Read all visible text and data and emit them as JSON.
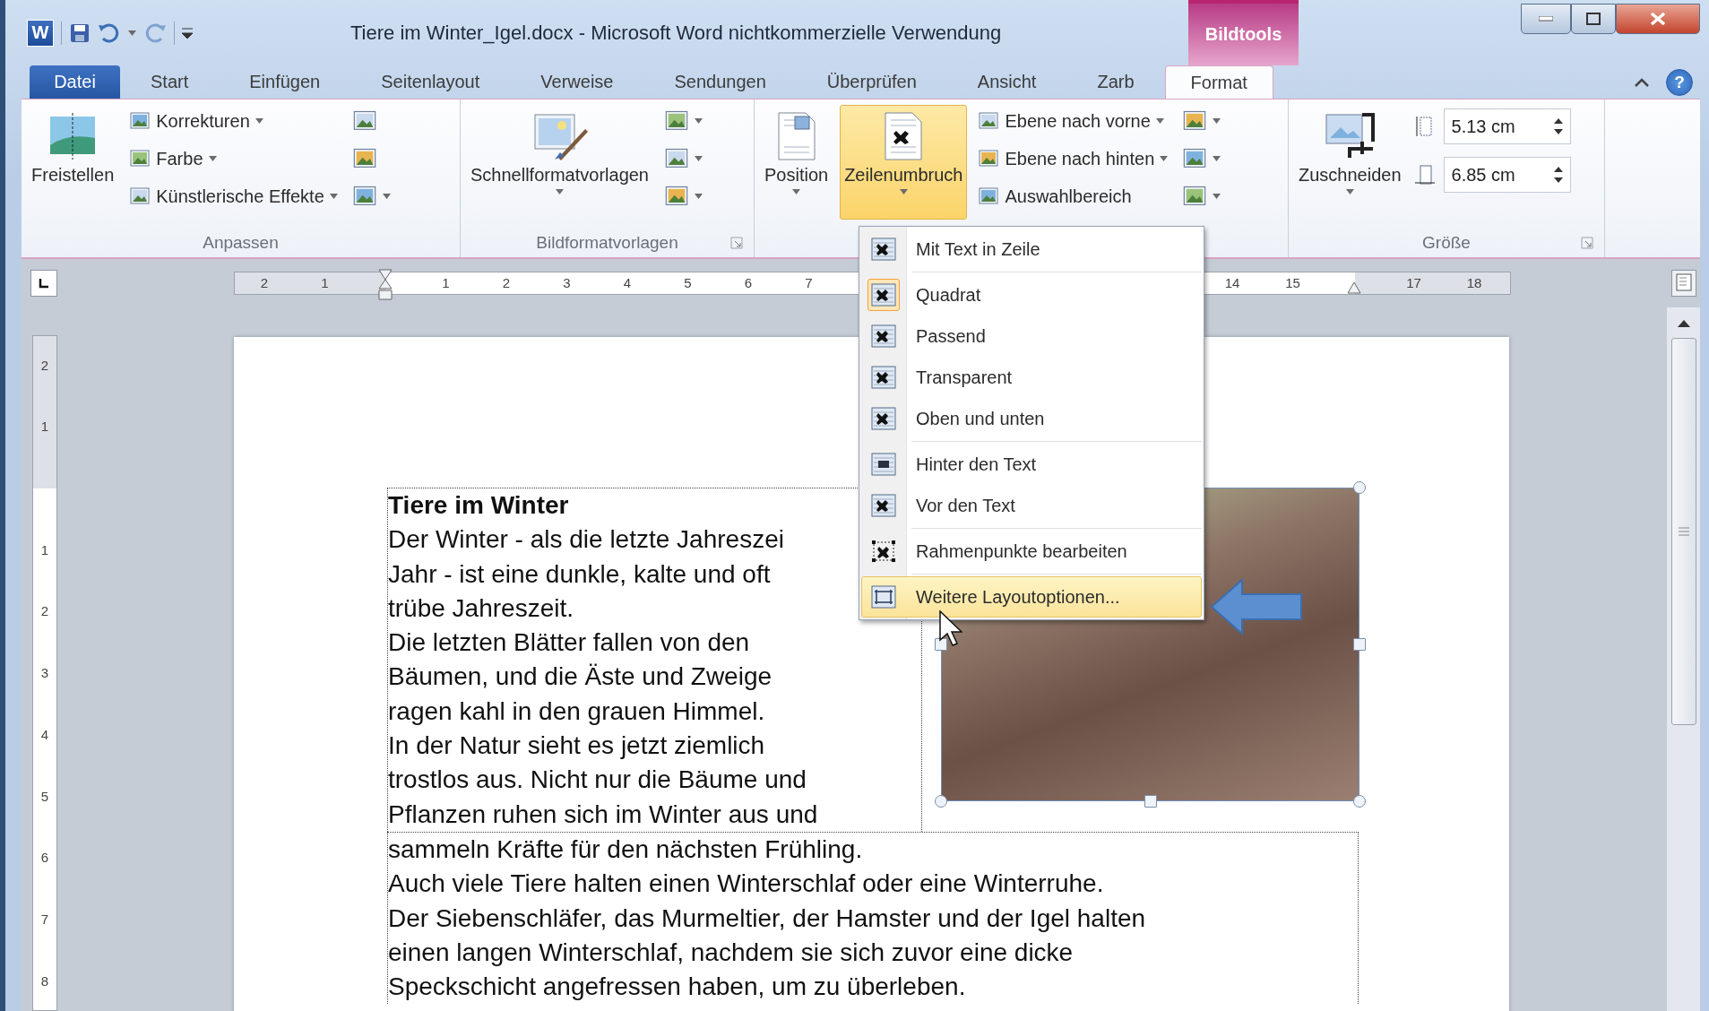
{
  "title_bar": {
    "app_icon": "W",
    "title": "Tiere im Winter_Igel.docx - Microsoft Word nichtkommerzielle Verwendung",
    "context_label": "Bildtools"
  },
  "tabs": [
    {
      "label": "Datei",
      "kind": "file",
      "selected": false
    },
    {
      "label": "Start",
      "kind": "normal",
      "selected": false
    },
    {
      "label": "Einfügen",
      "kind": "normal",
      "selected": false
    },
    {
      "label": "Seitenlayout",
      "kind": "normal",
      "selected": false
    },
    {
      "label": "Verweise",
      "kind": "normal",
      "selected": false
    },
    {
      "label": "Sendungen",
      "kind": "normal",
      "selected": false
    },
    {
      "label": "Überprüfen",
      "kind": "normal",
      "selected": false
    },
    {
      "label": "Ansicht",
      "kind": "normal",
      "selected": false
    },
    {
      "label": "Zarb",
      "kind": "normal",
      "selected": false
    },
    {
      "label": "Format",
      "kind": "context",
      "selected": true
    }
  ],
  "help": "?",
  "ribbon": {
    "groups": [
      {
        "label": "Anpassen",
        "launcher": false,
        "columns": [
          [
            {
              "kind": "large",
              "label": "Freistellen",
              "dropdown": false,
              "active": false
            }
          ],
          [
            {
              "kind": "small",
              "label": "Korrekturen",
              "dropdown": true
            },
            {
              "kind": "small",
              "label": "Farbe",
              "dropdown": true
            },
            {
              "kind": "small",
              "label": "Künstlerische Effekte",
              "dropdown": true
            }
          ],
          [
            {
              "kind": "icon",
              "dropdown": false
            },
            {
              "kind": "icon",
              "dropdown": false
            },
            {
              "kind": "icon",
              "dropdown": true
            }
          ]
        ]
      },
      {
        "label": "Bildformatvorlagen",
        "launcher": true,
        "columns": [
          [
            {
              "kind": "large",
              "label": "Schnellformatvorlagen",
              "dropdown": true,
              "active": false
            }
          ],
          [
            {
              "kind": "icon",
              "dropdown": true
            },
            {
              "kind": "icon",
              "dropdown": true
            },
            {
              "kind": "icon",
              "dropdown": true
            }
          ]
        ]
      },
      {
        "launcher": false,
        "columns": [
          [
            {
              "kind": "large",
              "label": "Position",
              "dropdown": true,
              "active": false
            }
          ],
          [
            {
              "kind": "large",
              "label": "Zeilenumbruch",
              "dropdown": true,
              "active": true
            }
          ],
          [
            {
              "kind": "small",
              "label": "Ebene nach vorne",
              "dropdown": true
            },
            {
              "kind": "small",
              "label": "Ebene nach hinten",
              "dropdown": true
            },
            {
              "kind": "small",
              "label": "Auswahlbereich",
              "dropdown": false
            }
          ],
          [
            {
              "kind": "icon",
              "dropdown": true
            },
            {
              "kind": "icon",
              "dropdown": true
            },
            {
              "kind": "icon",
              "dropdown": true
            }
          ]
        ]
      },
      {
        "label": "Größe",
        "launcher": true,
        "columns": [
          [
            {
              "kind": "large",
              "label": "Zuschneiden",
              "dropdown": true,
              "active": false
            }
          ],
          [
            {
              "kind": "spinner",
              "value": "5.13 cm"
            },
            {
              "kind": "spinner",
              "value": "6.85 cm"
            }
          ]
        ]
      }
    ]
  },
  "ruler": {
    "horizontal": [
      "2",
      "1",
      "1",
      "2",
      "3",
      "4",
      "5",
      "6",
      "7",
      "14",
      "15",
      "17",
      "18"
    ],
    "vertical": [
      "2",
      "1",
      "1",
      "2",
      "3",
      "4",
      "5",
      "6",
      "7",
      "8"
    ]
  },
  "document": {
    "heading": "Tiere im Winter",
    "column_lines": [
      "Der Winter - als die letzte Jahreszei",
      "Jahr - ist eine dunkle, kalte und oft",
      "trübe Jahreszeit.",
      "Die letzten Blätter fallen von den",
      "Bäumen, und die Äste und Zweige",
      "ragen kahl in den grauen Himmel.",
      "In der Natur sieht es jetzt ziemlich",
      "trostlos aus. Nicht nur die Bäume und",
      "Pflanzen ruhen sich im Winter aus und"
    ],
    "full_lines": [
      "sammeln Kräfte für den nächsten Frühling.",
      "Auch viele Tiere halten einen Winterschlaf oder eine Winterruhe.",
      "Der Siebenschläfer, das Murmeltier, der Hamster und der Igel halten",
      "einen langen Winterschlaf, nachdem sie sich zuvor eine dicke",
      "Speckschicht angefressen haben, um zu überleben."
    ]
  },
  "wrap_menu": {
    "items": [
      {
        "label": "Mit Text in Zeile",
        "kind": "wrap",
        "checked": false,
        "selected": false,
        "separator_before": false
      },
      {
        "label": "Quadrat",
        "kind": "wrap",
        "checked": true,
        "selected": false,
        "separator_before": true
      },
      {
        "label": "Passend",
        "kind": "wrap",
        "checked": false,
        "selected": false,
        "separator_before": false
      },
      {
        "label": "Transparent",
        "kind": "wrap",
        "checked": false,
        "selected": false,
        "separator_before": false
      },
      {
        "label": "Oben und unten",
        "kind": "wrap",
        "checked": false,
        "selected": false,
        "separator_before": false
      },
      {
        "label": "Hinter den Text",
        "kind": "behind",
        "checked": false,
        "selected": false,
        "separator_before": true
      },
      {
        "label": "Vor den Text",
        "kind": "wrap",
        "checked": false,
        "selected": false,
        "separator_before": false
      },
      {
        "label": "Rahmenpunkte bearbeiten",
        "kind": "points",
        "checked": false,
        "selected": false,
        "separator_before": true
      },
      {
        "label": "Weitere Layoutoptionen...",
        "kind": "layout",
        "checked": false,
        "selected": true,
        "separator_before": true
      }
    ]
  }
}
